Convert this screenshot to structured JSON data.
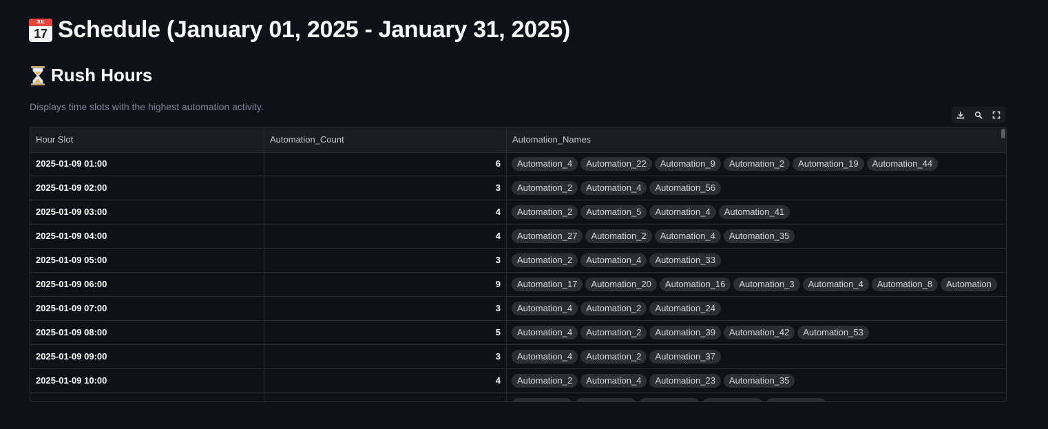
{
  "page": {
    "title": "Schedule (January 01, 2025 - January 31, 2025)",
    "calendar_icon_month": "JUL",
    "calendar_icon_day": "17"
  },
  "section": {
    "title": "Rush Hours",
    "caption": "Displays time slots with the highest automation activity."
  },
  "toolbar": {
    "icons": [
      "download-icon",
      "search-icon",
      "fullscreen-icon"
    ]
  },
  "table": {
    "columns": [
      "Hour Slot",
      "Automation_Count",
      "Automation_Names"
    ],
    "rows": [
      {
        "hour_slot": "2025-01-09 01:00",
        "count": "6",
        "names": [
          "Automation_4",
          "Automation_22",
          "Automation_9",
          "Automation_2",
          "Automation_19",
          "Automation_44"
        ]
      },
      {
        "hour_slot": "2025-01-09 02:00",
        "count": "3",
        "names": [
          "Automation_2",
          "Automation_4",
          "Automation_56"
        ]
      },
      {
        "hour_slot": "2025-01-09 03:00",
        "count": "4",
        "names": [
          "Automation_2",
          "Automation_5",
          "Automation_4",
          "Automation_41"
        ]
      },
      {
        "hour_slot": "2025-01-09 04:00",
        "count": "4",
        "names": [
          "Automation_27",
          "Automation_2",
          "Automation_4",
          "Automation_35"
        ]
      },
      {
        "hour_slot": "2025-01-09 05:00",
        "count": "3",
        "names": [
          "Automation_2",
          "Automation_4",
          "Automation_33"
        ]
      },
      {
        "hour_slot": "2025-01-09 06:00",
        "count": "9",
        "names": [
          "Automation_17",
          "Automation_20",
          "Automation_16",
          "Automation_3",
          "Automation_4",
          "Automation_8",
          "Automation"
        ]
      },
      {
        "hour_slot": "2025-01-09 07:00",
        "count": "3",
        "names": [
          "Automation_4",
          "Automation_2",
          "Automation_24"
        ]
      },
      {
        "hour_slot": "2025-01-09 08:00",
        "count": "5",
        "names": [
          "Automation_4",
          "Automation_2",
          "Automation_39",
          "Automation_42",
          "Automation_53"
        ]
      },
      {
        "hour_slot": "2025-01-09 09:00",
        "count": "3",
        "names": [
          "Automation_4",
          "Automation_2",
          "Automation_37"
        ]
      },
      {
        "hour_slot": "2025-01-09 10:00",
        "count": "4",
        "names": [
          "Automation_2",
          "Automation_4",
          "Automation_23",
          "Automation_35"
        ]
      }
    ]
  },
  "colors": {
    "background": "#0e1117",
    "header_bg": "#1a1c23",
    "border": "#2b2e36",
    "tag_bg": "#2b2e37",
    "caption": "#808495"
  }
}
